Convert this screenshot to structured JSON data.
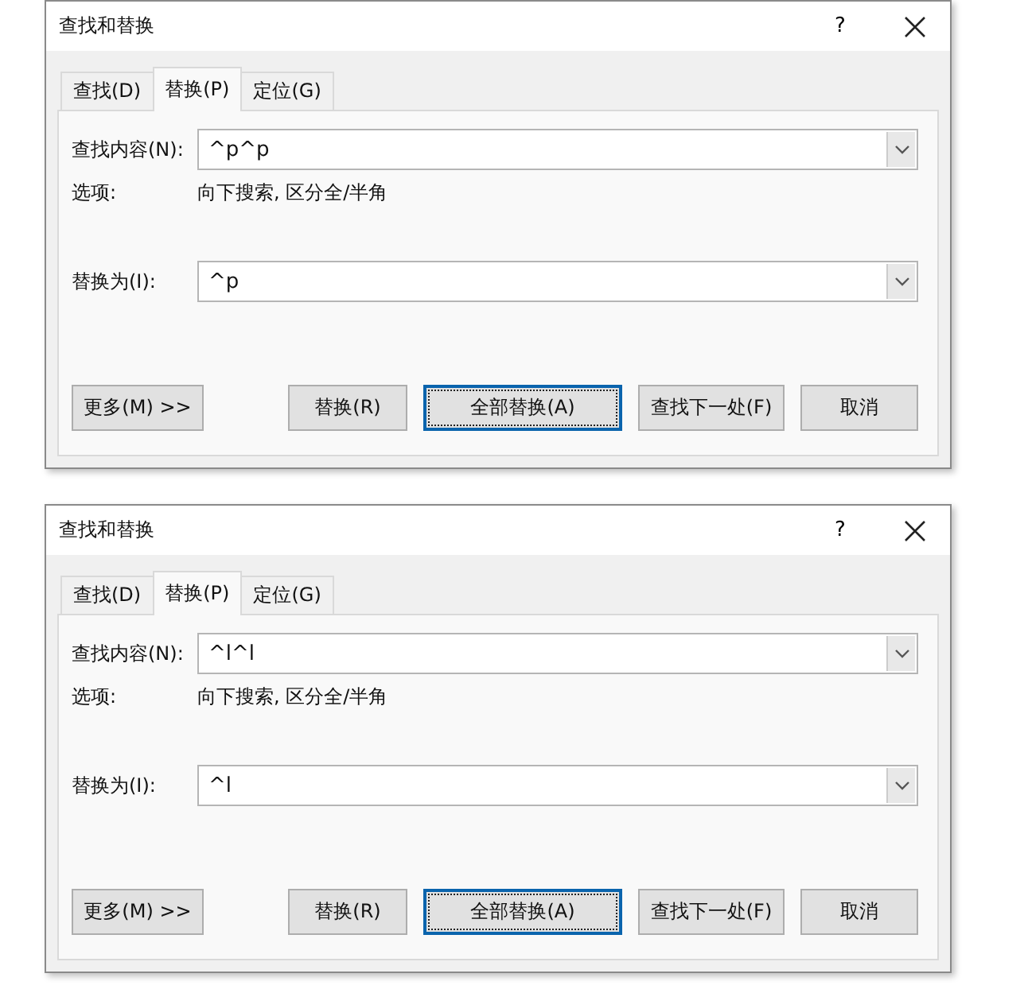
{
  "dialogs": [
    {
      "title": "查找和替换",
      "help": "?",
      "tabs": [
        {
          "label": "查找(D)",
          "selected": false
        },
        {
          "label": "替换(P)",
          "selected": true
        },
        {
          "label": "定位(G)",
          "selected": false
        }
      ],
      "find_label": "查找内容(N):",
      "find_value": "^p^p",
      "options_label": "选项:",
      "options_value": "向下搜索, 区分全/半角",
      "replace_label": "替换为(I):",
      "replace_value": "^p",
      "more_button": "更多(M) >>",
      "buttons": [
        {
          "label": "替换(R)",
          "default": false
        },
        {
          "label": "全部替换(A)",
          "default": true
        },
        {
          "label": "查找下一处(F)",
          "default": false
        },
        {
          "label": "取消",
          "default": false
        }
      ]
    },
    {
      "title": "查找和替换",
      "help": "?",
      "tabs": [
        {
          "label": "查找(D)",
          "selected": false
        },
        {
          "label": "替换(P)",
          "selected": true
        },
        {
          "label": "定位(G)",
          "selected": false
        }
      ],
      "find_label": "查找内容(N):",
      "find_value": "^l^l",
      "options_label": "选项:",
      "options_value": "向下搜索, 区分全/半角",
      "replace_label": "替换为(I):",
      "replace_value": "^l",
      "more_button": "更多(M) >>",
      "buttons": [
        {
          "label": "替换(R)",
          "default": false
        },
        {
          "label": "全部替换(A)",
          "default": true
        },
        {
          "label": "查找下一处(F)",
          "default": false
        },
        {
          "label": "取消",
          "default": false
        }
      ]
    }
  ]
}
